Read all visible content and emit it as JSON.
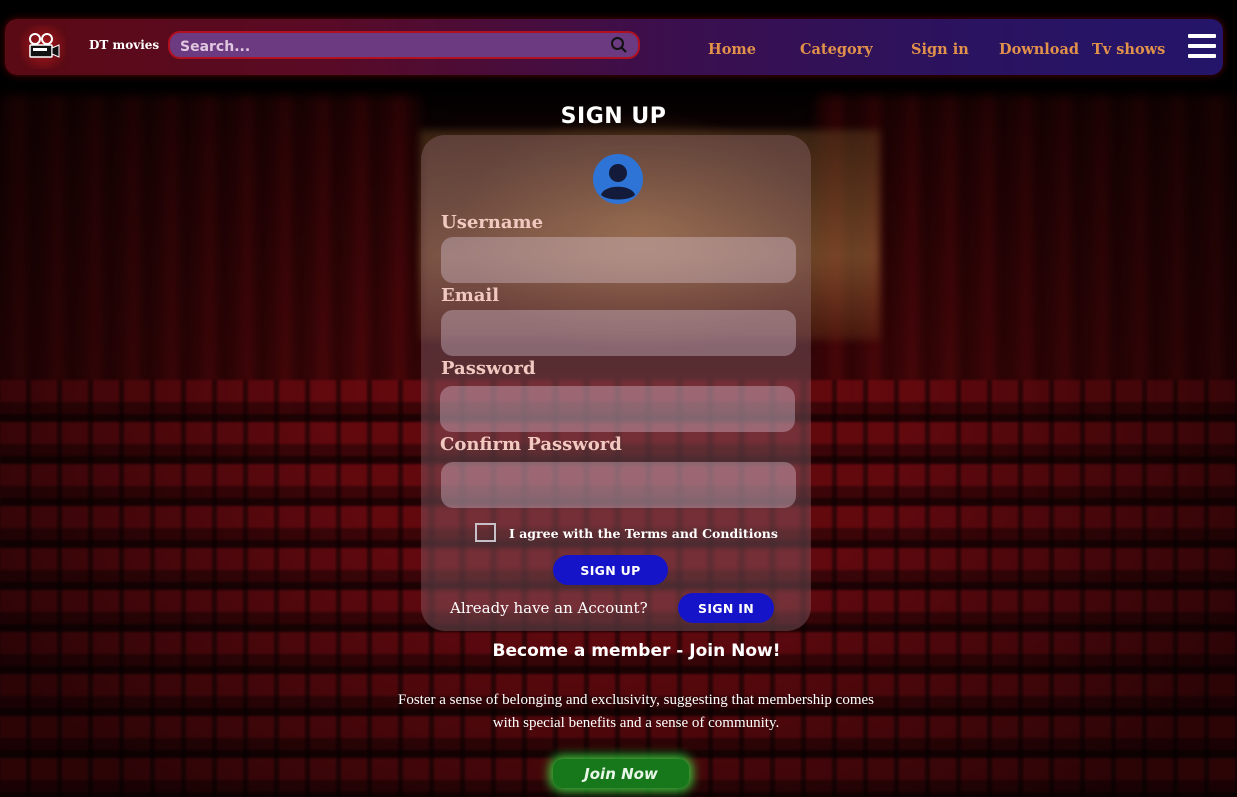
{
  "colors": {
    "nav_link": "#e1914a",
    "primary_button": "#1614c8",
    "join_button": "#16781a",
    "label": "#f2c9c0"
  },
  "header": {
    "logo_icon": "film-projector-icon",
    "brand": "DT movies",
    "search_placeholder": "Search...",
    "nav": [
      {
        "label": "Home"
      },
      {
        "label": "Category"
      },
      {
        "label": "Sign in"
      },
      {
        "label": "Download"
      },
      {
        "label": "Tv shows"
      }
    ],
    "menu_icon": "hamburger-menu-icon"
  },
  "signup": {
    "title": "SIGN UP",
    "avatar_icon": "user-avatar-icon",
    "fields": {
      "username": {
        "label": "Username",
        "value": ""
      },
      "email": {
        "label": "Email",
        "value": ""
      },
      "password": {
        "label": "Password",
        "value": ""
      },
      "confirm": {
        "label": "Confirm Password",
        "value": ""
      }
    },
    "terms": "I agree with the Terms and Conditions",
    "terms_checked": false,
    "submit": "SIGN UP",
    "already": "Already have an Account?",
    "signin": "SIGN IN"
  },
  "promo": {
    "heading": "Become a member - Join Now!",
    "text_line1": "Foster a sense of belonging and exclusivity, suggesting that membership comes",
    "text_line2": "with special benefits and a sense of community.",
    "button": "Join Now"
  }
}
